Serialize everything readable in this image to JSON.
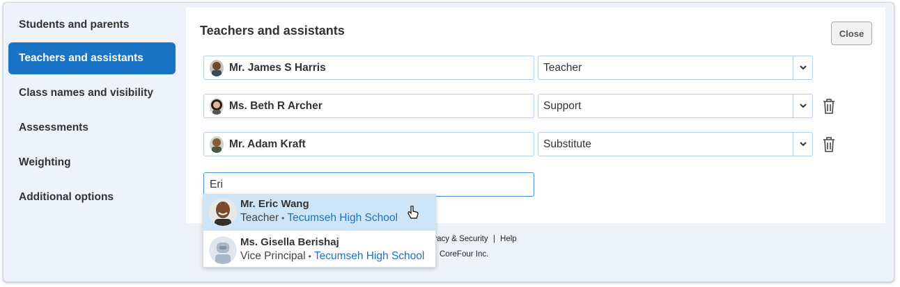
{
  "sidebar": {
    "items": [
      {
        "label": "Students and parents",
        "active": false
      },
      {
        "label": "Teachers and assistants",
        "active": true
      },
      {
        "label": "Class names and visibility",
        "active": false
      },
      {
        "label": "Assessments",
        "active": false
      },
      {
        "label": "Weighting",
        "active": false
      },
      {
        "label": "Additional options",
        "active": false
      }
    ]
  },
  "main": {
    "title": "Teachers and assistants",
    "close_label": "Close",
    "staff": [
      {
        "name": "Mr. James S Harris",
        "role": "Teacher",
        "deletable": false
      },
      {
        "name": "Ms. Beth R Archer",
        "role": "Support",
        "deletable": true
      },
      {
        "name": "Mr. Adam Kraft",
        "role": "Substitute",
        "deletable": true
      }
    ],
    "search": {
      "value": "Eri",
      "placeholder": ""
    }
  },
  "dropdown": {
    "results": [
      {
        "name": "Mr. Eric Wang",
        "role": "Teacher",
        "separator": "•",
        "school": "Tecumseh High School",
        "avatar": "photo"
      },
      {
        "name": "Ms. Gisella Berishaj",
        "role": "Vice Principal",
        "separator": "•",
        "school": "Tecumseh High School",
        "avatar": "robot-placeholder"
      }
    ]
  },
  "footer": {
    "privacy": "rivacy & Security",
    "sep": "|",
    "help": "Help",
    "copyright": "CoreFour Inc."
  },
  "colors": {
    "accent": "#1a73c4",
    "hover": "#cde5f7",
    "background": "#eef3f9"
  },
  "icons": [
    "chevron-down-icon",
    "trash-icon",
    "pointer-cursor-icon"
  ]
}
